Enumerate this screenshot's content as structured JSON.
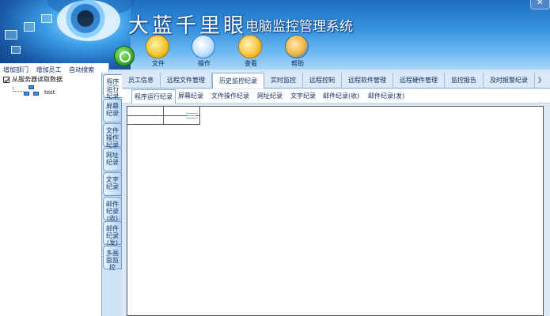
{
  "app": {
    "title_main": "大蓝千里眼",
    "title_sub": "电脑监控管理系统",
    "close_symbol": "✕"
  },
  "toolbar": {
    "file_label": "文件",
    "operate_label": "操作",
    "view_label": "查看",
    "help_label": "帮助"
  },
  "left_panel": {
    "links": [
      "增加部门",
      "增加员工",
      "自动搜索"
    ],
    "checkbox_label": "从服务器读取数据",
    "checkbox_checked": true,
    "tree_node_label": "test"
  },
  "vertical_tabs": [
    {
      "label": "程序运行纪录"
    },
    {
      "label": "屏幕纪录"
    },
    {
      "label": "文件操作纪录"
    },
    {
      "label": "网址纪录"
    },
    {
      "label": "文字纪录"
    },
    {
      "label": "邮件纪录(收)"
    },
    {
      "label": "邮件纪录(发)"
    },
    {
      "label": "多画面监控"
    }
  ],
  "top_tabs": [
    {
      "label": "员工信息"
    },
    {
      "label": "远程文件管理"
    },
    {
      "label": "历史监控纪录",
      "active": true
    },
    {
      "label": "实时监控"
    },
    {
      "label": "远程控制"
    },
    {
      "label": "远程软件管理"
    },
    {
      "label": "远程硬件管理"
    },
    {
      "label": "监控报告"
    },
    {
      "label": "及时报警纪录"
    },
    {
      "label": "》"
    }
  ],
  "sub_tabs": [
    {
      "label": "程序运行纪录",
      "active": true
    },
    {
      "label": "屏幕纪录"
    },
    {
      "label": "文件操作纪录"
    },
    {
      "label": "网址纪录"
    },
    {
      "label": "文字纪录"
    },
    {
      "label": "邮件纪录(收)"
    },
    {
      "label": "邮件纪录(发)"
    }
  ],
  "colors": {
    "banner_top": "#1d6fc0",
    "banner_bottom": "#a9d6f7",
    "panel_bg": "#d6e6f5",
    "accent_green": "#2f9f1c"
  },
  "icons": {
    "go": "circle-go-icon",
    "file": "folder-icon",
    "operate": "document-pen-icon",
    "view": "magnifier-icon",
    "help": "lifebuoy-icon"
  }
}
